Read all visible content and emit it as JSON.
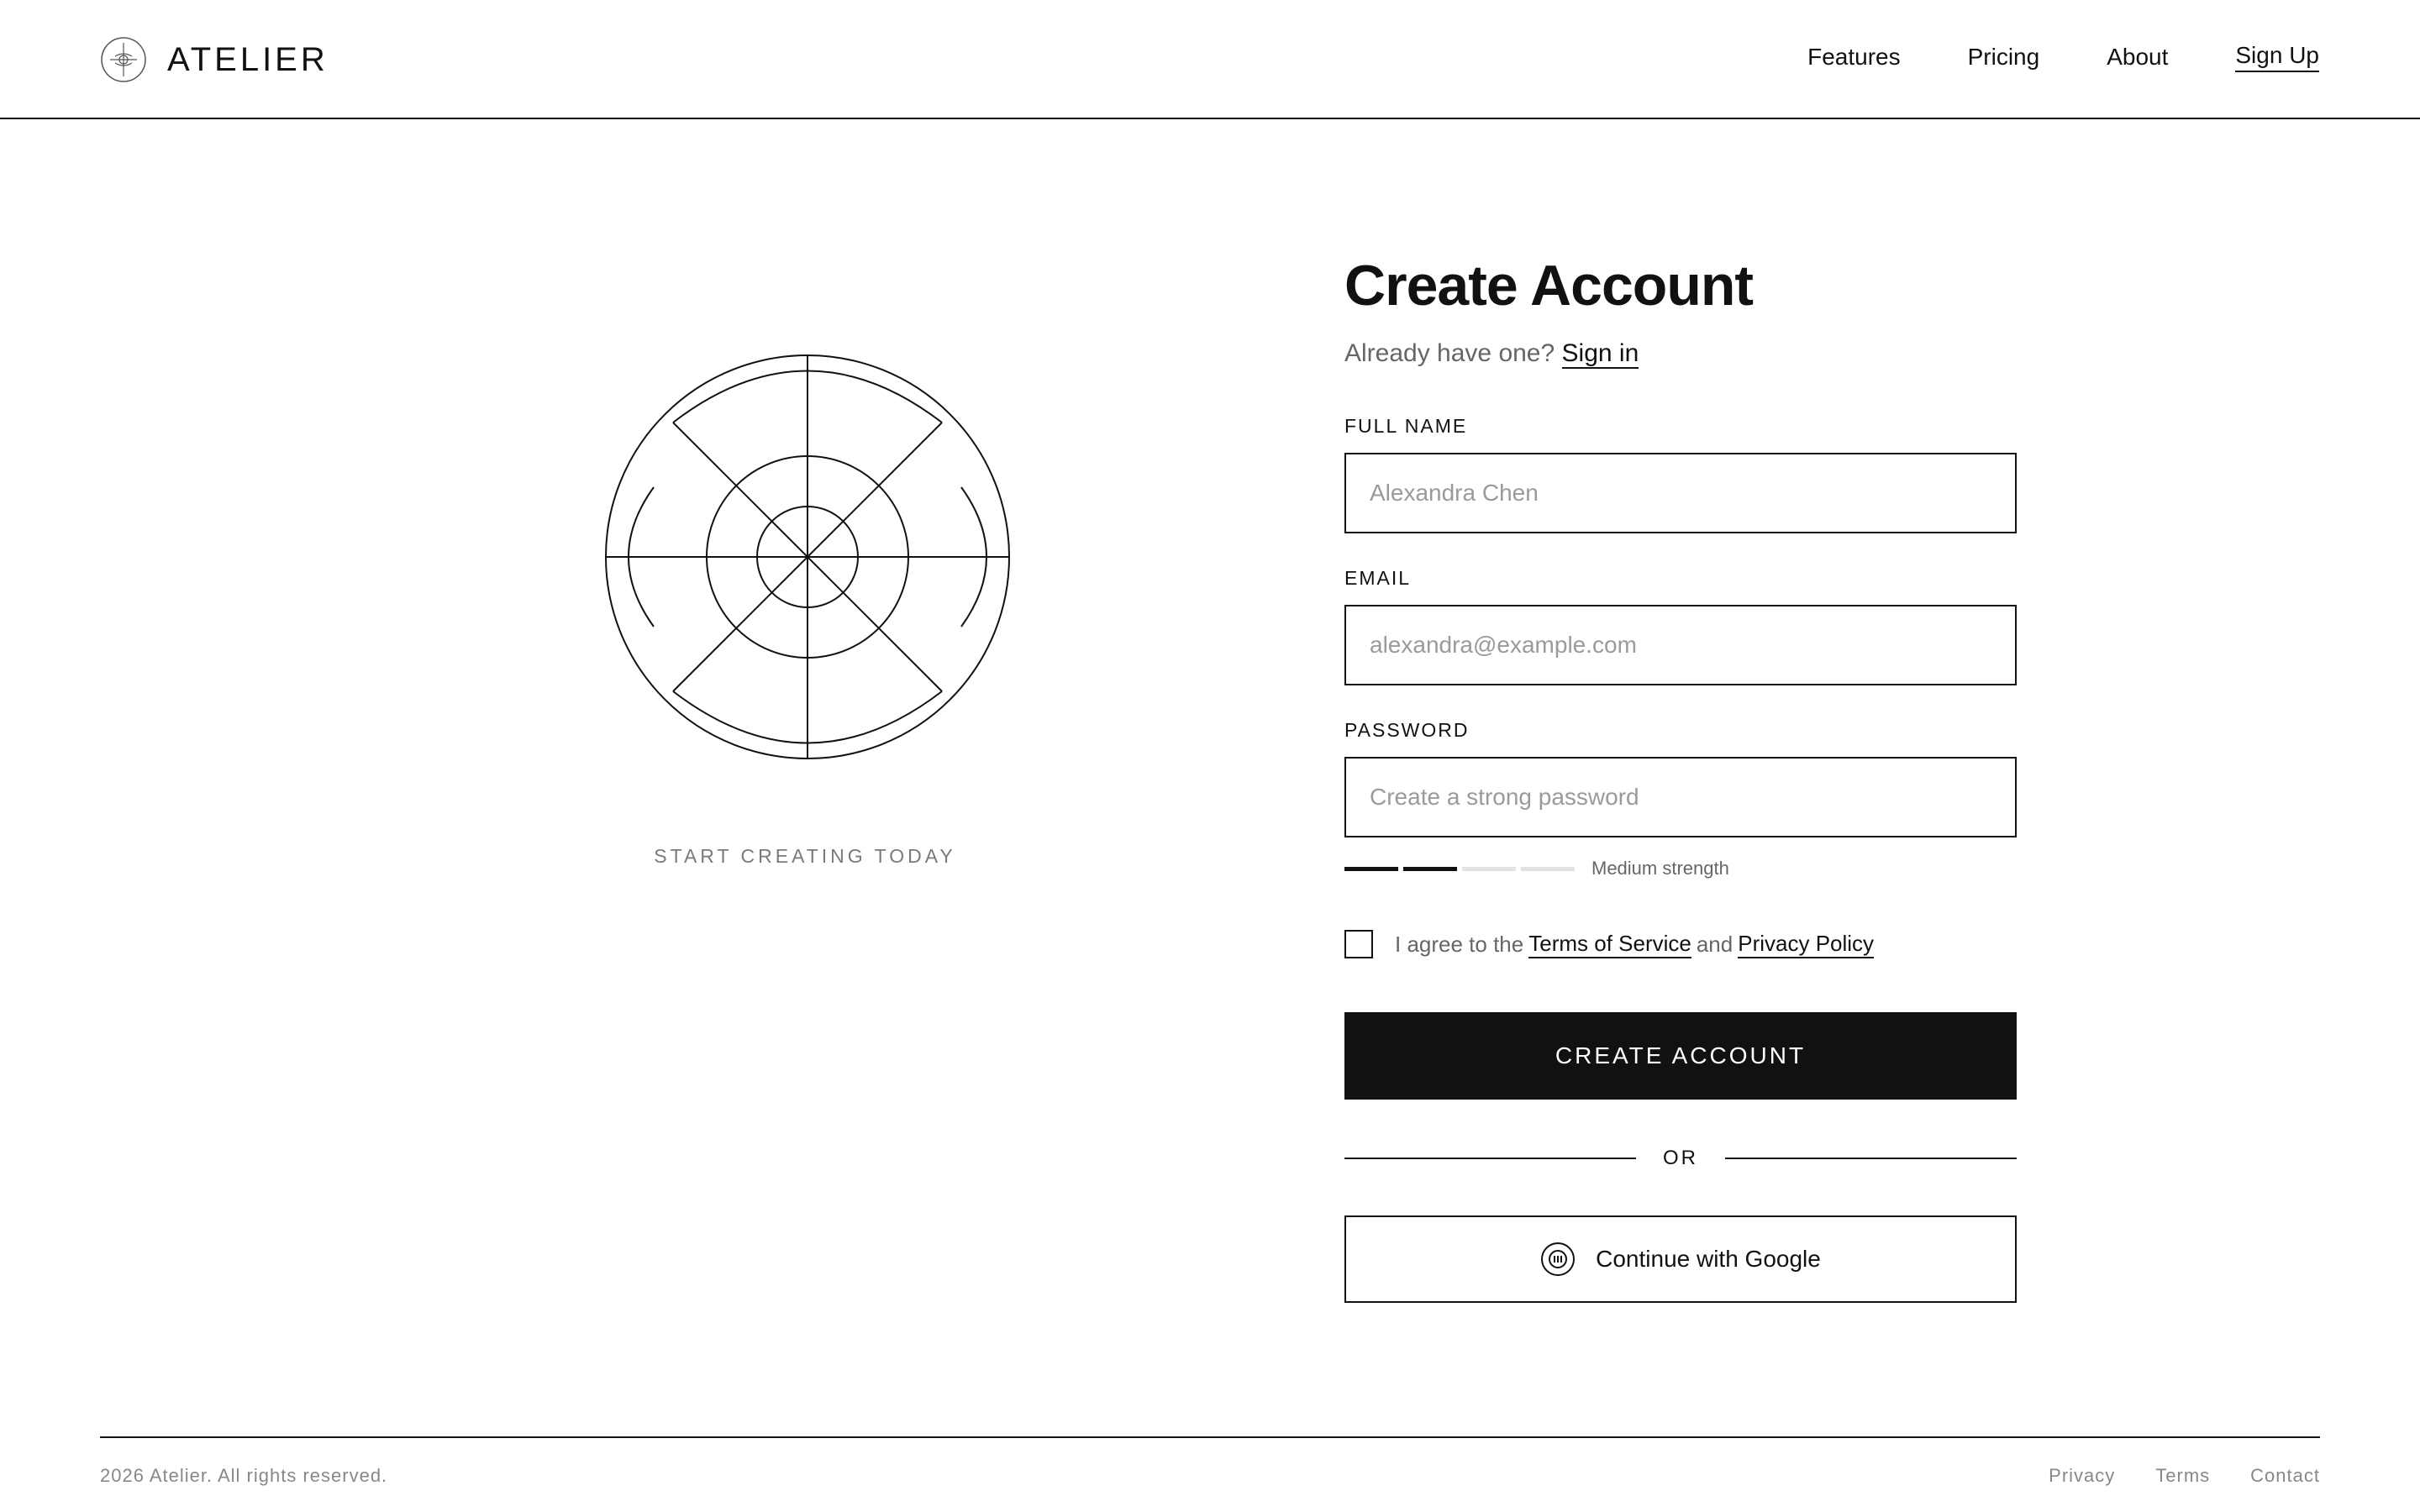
{
  "header": {
    "brand": "ATELIER",
    "brand_icon": "atelier-logo-icon",
    "nav": [
      "Features",
      "Pricing",
      "About",
      "Sign Up"
    ]
  },
  "hero": {
    "caption": "START CREATING TODAY",
    "illustration": "radial-geometric-emblem"
  },
  "form": {
    "title": "Create Account",
    "subtitle_prefix": "Already have one?",
    "signin_link": "Sign in",
    "fields": {
      "full_name": {
        "label": "FULL NAME",
        "placeholder": "Alexandra Chen",
        "value": ""
      },
      "email": {
        "label": "EMAIL",
        "placeholder": "alexandra@example.com",
        "value": ""
      },
      "password": {
        "label": "PASSWORD",
        "placeholder": "Create a strong password",
        "value": ""
      }
    },
    "strength": {
      "segments_total": 4,
      "segments_filled": 2,
      "label": "Medium strength"
    },
    "agree": {
      "checked": false,
      "prefix": "I agree to the",
      "terms_link": "Terms of Service",
      "and": "and",
      "privacy_link": "Privacy Policy"
    },
    "submit_label": "CREATE ACCOUNT",
    "divider": "OR",
    "google_label": "Continue with Google",
    "google_icon": "google-circle-icon"
  },
  "footer": {
    "copyright": "2026 Atelier. All rights reserved.",
    "links": [
      "Privacy",
      "Terms",
      "Contact"
    ]
  },
  "colors": {
    "ink": "#111111",
    "muted": "#666666",
    "placeholder": "#9a9a9a",
    "track": "#e2e2e2",
    "bg": "#ffffff"
  }
}
